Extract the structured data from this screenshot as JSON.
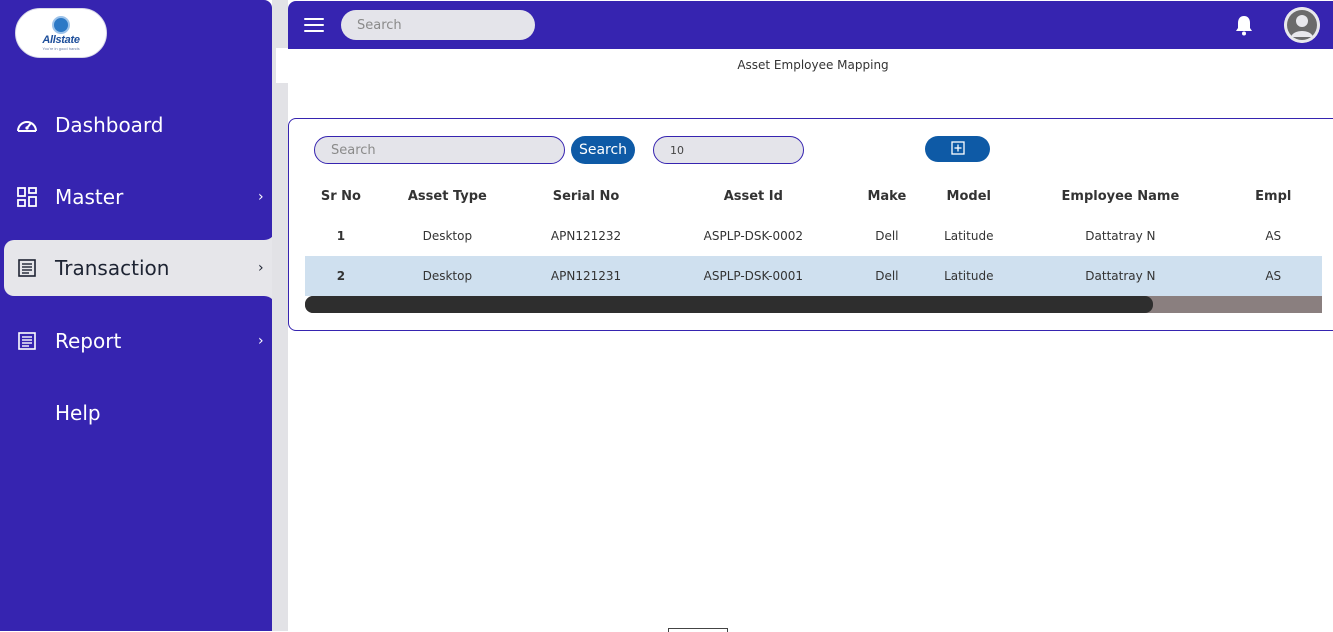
{
  "logo": {
    "name": "Allstate",
    "tagline": "You're in good hands"
  },
  "sidebar": {
    "items": [
      {
        "label": "Dashboard",
        "icon": "dashboard-gauge-icon",
        "has_arrow": false
      },
      {
        "label": "Master",
        "icon": "grid-icon",
        "has_arrow": true,
        "arrow": "›"
      },
      {
        "label": "Transaction",
        "icon": "receipt-icon",
        "has_arrow": true,
        "arrow": "›",
        "active": true
      },
      {
        "label": "Report",
        "icon": "report-icon",
        "has_arrow": true,
        "arrow": "›"
      },
      {
        "label": "Help",
        "icon": "",
        "has_arrow": false
      }
    ]
  },
  "topbar": {
    "search_placeholder": "Search"
  },
  "page": {
    "title": "Asset Employee Mapping"
  },
  "toolbar": {
    "search_placeholder": "Search",
    "search_button": "Search",
    "page_size": "10"
  },
  "table": {
    "columns": [
      "Sr No",
      "Asset Type",
      "Serial No",
      "Asset Id",
      "Make",
      "Model",
      "Employee Name",
      "Empl"
    ],
    "rows": [
      [
        "1",
        "Desktop",
        "APN121232",
        "ASPLP-DSK-0002",
        "Dell",
        "Latitude",
        "Dattatray N",
        "AS"
      ],
      [
        "2",
        "Desktop",
        "APN121231",
        "ASPLP-DSK-0001",
        "Dell",
        "Latitude",
        "Dattatray N",
        "AS"
      ]
    ]
  },
  "colors": {
    "primary": "#3624b0",
    "button": "#0e5aa6",
    "row_highlight": "#cfe0ef",
    "active_nav": "#e6e6ea"
  }
}
